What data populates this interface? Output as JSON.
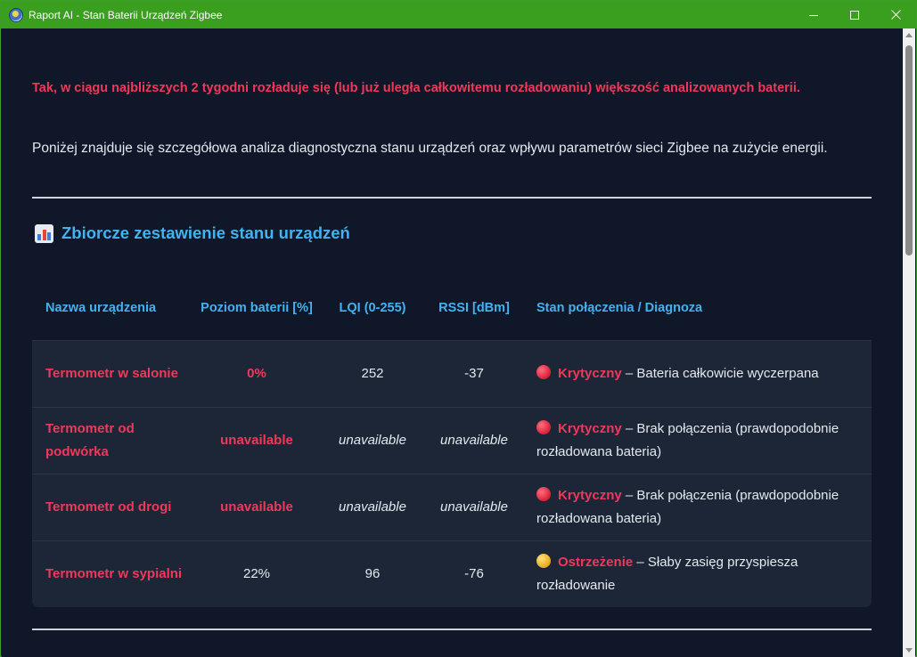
{
  "window": {
    "title": "Raport AI - Stan Baterii Urządzeń Zigbee"
  },
  "report": {
    "alert": "Tak, w ciągu najbliższych 2 tygodni rozładuje się (lub już uległa całkowitemu rozładowaniu) większość analizowanych baterii.",
    "intro": "Poniżej znajduje się szczegółowa analiza diagnostyczna stanu urządzeń oraz wpływu parametrów sieci Zigbee na zużycie energii.",
    "section_title": "Zbiorcze zestawienie stanu urządzeń"
  },
  "table": {
    "headers": [
      "Nazwa urządzenia",
      "Poziom baterii [%]",
      "LQI (0-255)",
      "RSSI [dBm]",
      "Stan połączenia / Diagnoza"
    ],
    "rows": [
      {
        "name": "Termometr w salonie",
        "battery": "0%",
        "lqi": "252",
        "rssi": "-37",
        "status": "Krytyczny",
        "diagnosis": " – Bateria całkowicie wyczerpana",
        "level": "critical"
      },
      {
        "name": "Termometr od podwórka",
        "battery": "unavailable",
        "lqi": "unavailable",
        "rssi": "unavailable",
        "status": "Krytyczny",
        "diagnosis": " – Brak połączenia (prawdopodobnie rozładowana bateria)",
        "level": "critical"
      },
      {
        "name": "Termometr od drogi",
        "battery": "unavailable",
        "lqi": "unavailable",
        "rssi": "unavailable",
        "status": "Krytyczny",
        "diagnosis": " – Brak połączenia (prawdopodobnie rozładowana bateria)",
        "level": "critical"
      },
      {
        "name": "Termometr w sypialni",
        "battery": "22%",
        "lqi": "96",
        "rssi": "-76",
        "status": "Ostrzeżenie",
        "diagnosis": " – Słaby zasięg przyspiesza rozładowanie",
        "level": "warning"
      }
    ]
  },
  "colors": {
    "titlebar": "#3a9e1e",
    "accent_red": "#f0385a",
    "accent_blue": "#43b2f0",
    "background": "#0f1729",
    "row_background": "#1c2637"
  },
  "icons": {
    "app": "app-logo-icon",
    "section": "bar-chart-icon",
    "critical": "red-circle-icon",
    "warning": "yellow-circle-icon"
  }
}
